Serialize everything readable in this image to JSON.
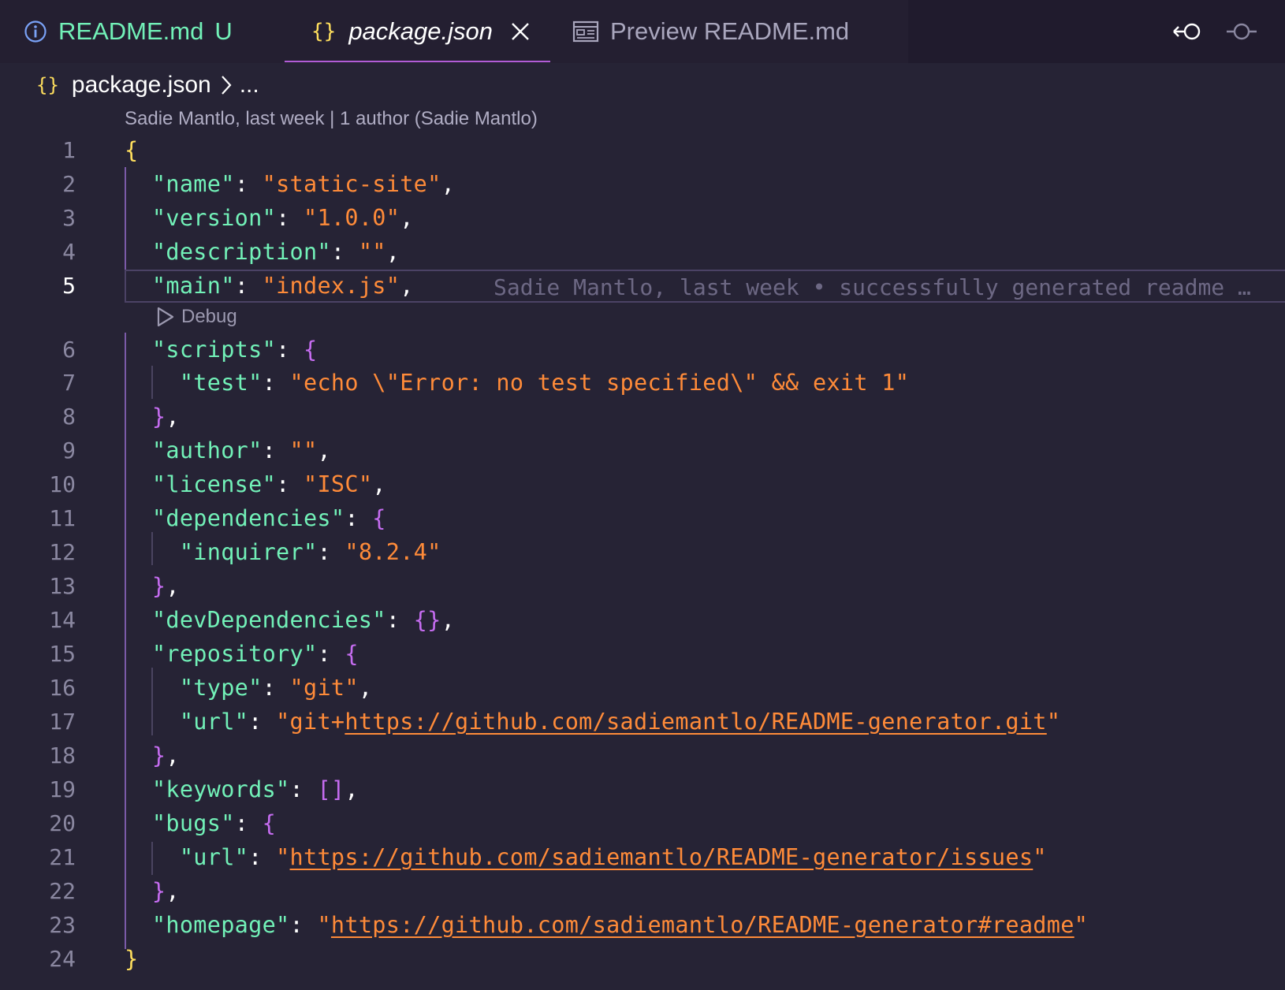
{
  "tabs": {
    "readme": {
      "label": "README.md",
      "status": "U"
    },
    "package": {
      "label": "package.json",
      "icon": "{}"
    },
    "preview": {
      "label": "Preview README.md"
    }
  },
  "breadcrumb": {
    "icon": "{}",
    "file": "package.json",
    "more": "..."
  },
  "blame_header": "Sadie Mantlo, last week | 1 author (Sadie Mantlo)",
  "inline_blame": "Sadie Mantlo, last week • successfully generated readme …",
  "codelens": {
    "label": "Debug"
  },
  "line_numbers": [
    "1",
    "2",
    "3",
    "4",
    "5",
    "6",
    "7",
    "8",
    "9",
    "10",
    "11",
    "12",
    "13",
    "14",
    "15",
    "16",
    "17",
    "18",
    "19",
    "20",
    "21",
    "22",
    "23",
    "24"
  ],
  "active_line": "5",
  "code": {
    "l1_open": "{",
    "l2_key": "\"name\"",
    "l2_val": "\"static-site\"",
    "l3_key": "\"version\"",
    "l3_val": "\"1.0.0\"",
    "l4_key": "\"description\"",
    "l4_val": "\"\"",
    "l5_key": "\"main\"",
    "l5_val": "\"index.js\"",
    "l6_key": "\"scripts\"",
    "l6_brace": "{",
    "l7_key": "\"test\"",
    "l7_val": "\"echo \\\"Error: no test specified\\\" && exit 1\"",
    "l8_close": "}",
    "l9_key": "\"author\"",
    "l9_val": "\"\"",
    "l10_key": "\"license\"",
    "l10_val": "\"ISC\"",
    "l11_key": "\"dependencies\"",
    "l11_brace": "{",
    "l12_key": "\"inquirer\"",
    "l12_val": "\"8.2.4\"",
    "l13_close": "}",
    "l14_key": "\"devDependencies\"",
    "l14_val": "{}",
    "l15_key": "\"repository\"",
    "l15_brace": "{",
    "l16_key": "\"type\"",
    "l16_val": "\"git\"",
    "l17_key": "\"url\"",
    "l17_pre": "\"git+",
    "l17_link": "https://github.com/sadiemantlo/README-generator.git",
    "l17_post": "\"",
    "l18_close": "}",
    "l19_key": "\"keywords\"",
    "l19_val": "[]",
    "l20_key": "\"bugs\"",
    "l20_brace": "{",
    "l21_key": "\"url\"",
    "l21_pre": "\"",
    "l21_link": "https://github.com/sadiemantlo/README-generator/issues",
    "l21_post": "\"",
    "l22_close": "}",
    "l23_key": "\"homepage\"",
    "l23_pre": "\"",
    "l23_link": "https://github.com/sadiemantlo/README-generator#readme",
    "l23_post": "\"",
    "l24_close": "}"
  },
  "colors": {
    "background": "#262335",
    "key": "#72f1b8",
    "string": "#ff8b39",
    "brace": "#fede5d",
    "nested_brace": "#c56cf0",
    "tab_accent": "#b15cd6"
  },
  "icons": [
    "info-icon",
    "json-file-icon",
    "close-icon",
    "preview-icon",
    "go-back-icon",
    "timeline-icon",
    "chevron-right-icon",
    "play-icon"
  ]
}
